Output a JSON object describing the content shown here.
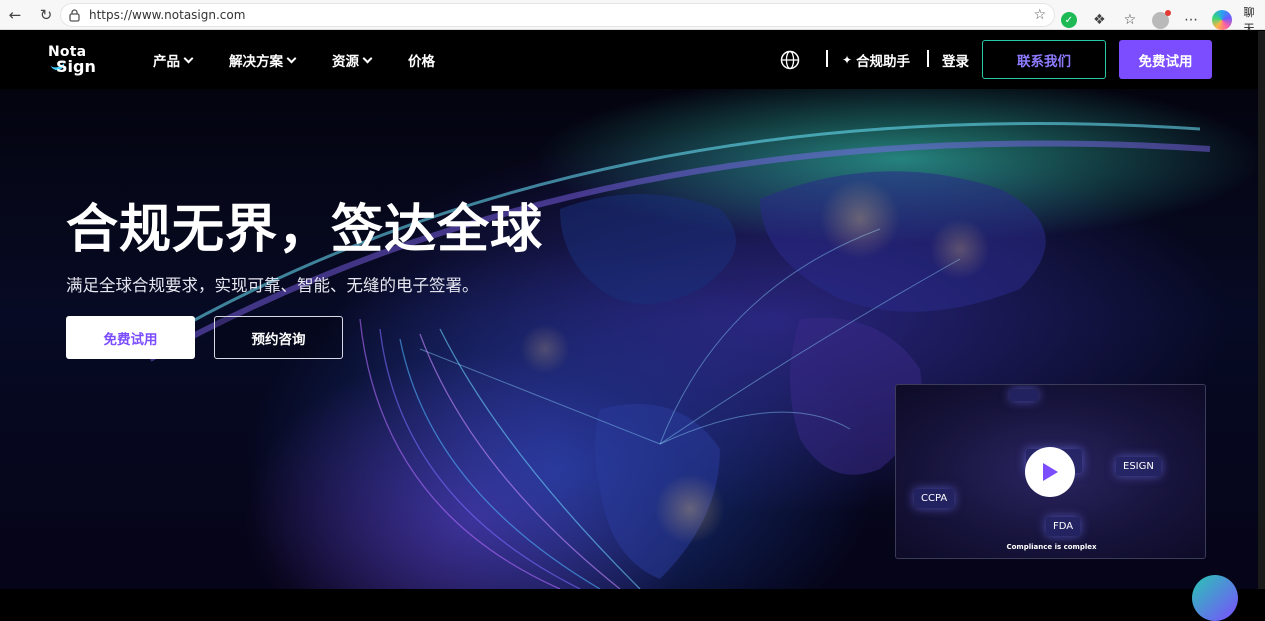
{
  "browser": {
    "url": "https://www.notasign.com",
    "chat_label": "聊天"
  },
  "nav": {
    "logo_line1": "Nota",
    "logo_line2": "Sign",
    "menu": [
      {
        "label": "产品"
      },
      {
        "label": "解决方案"
      },
      {
        "label": "资源"
      },
      {
        "label": "价格"
      }
    ],
    "assistant_label": "合规助手",
    "login_label": "登录",
    "contact_label": "联系我们",
    "trial_label": "免费试用"
  },
  "hero": {
    "title": "合规无界，签达全球",
    "subtitle": "满足全球合规要求，实现可靠、智能、无缝的电子签署。",
    "primary_button": "免费试用",
    "secondary_button": "预约咨询"
  },
  "video": {
    "chips": [
      "ESIGN",
      "CCPA",
      "FDA"
    ],
    "caption": "Compliance is complex"
  },
  "colors": {
    "accent": "#7b4dff",
    "contact_border": "#24c9a6",
    "contact_text": "#8d7bff"
  }
}
